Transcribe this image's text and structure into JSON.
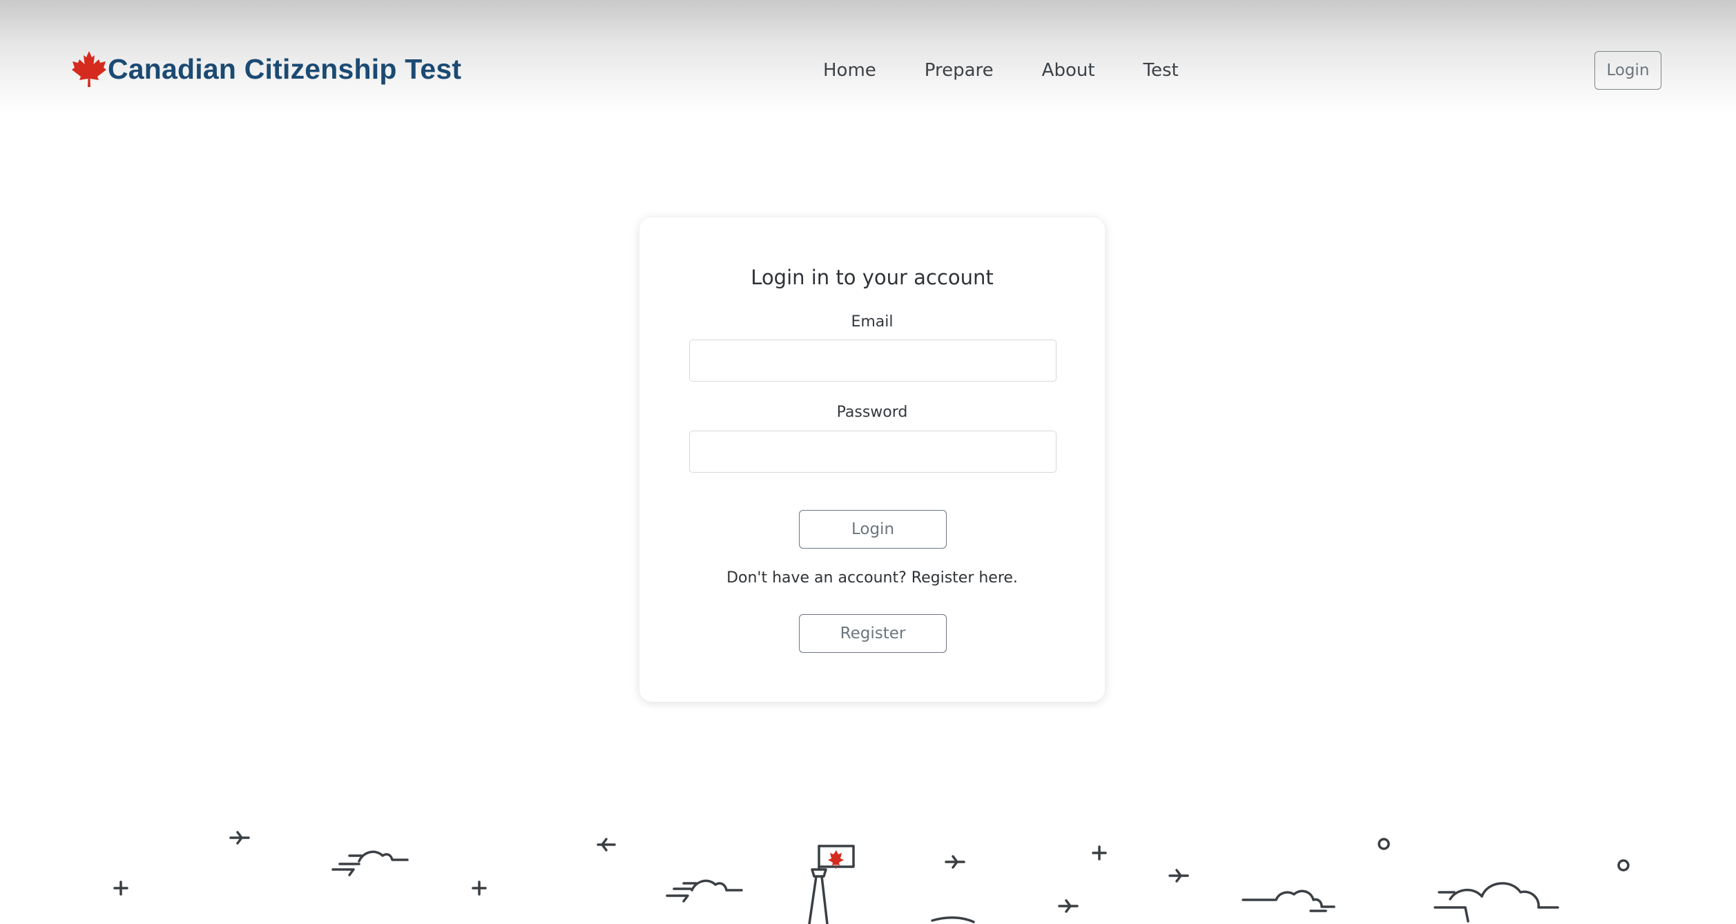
{
  "header": {
    "brand_title": "Canadian Citizenship Test",
    "brand_icon": "maple-leaf-icon",
    "nav": [
      {
        "label": "Home"
      },
      {
        "label": "Prepare"
      },
      {
        "label": "About"
      },
      {
        "label": "Test"
      }
    ],
    "login_label": "Login"
  },
  "login_card": {
    "title": "Login in to your account",
    "email_label": "Email",
    "email_value": "",
    "password_label": "Password",
    "password_value": "",
    "login_button": "Login",
    "register_prompt": "Don't have an account? Register here.",
    "register_button": "Register"
  },
  "colors": {
    "brand_text": "#1b4a73",
    "maple_leaf": "#d52b1e",
    "button_outline": "#6c757d"
  }
}
